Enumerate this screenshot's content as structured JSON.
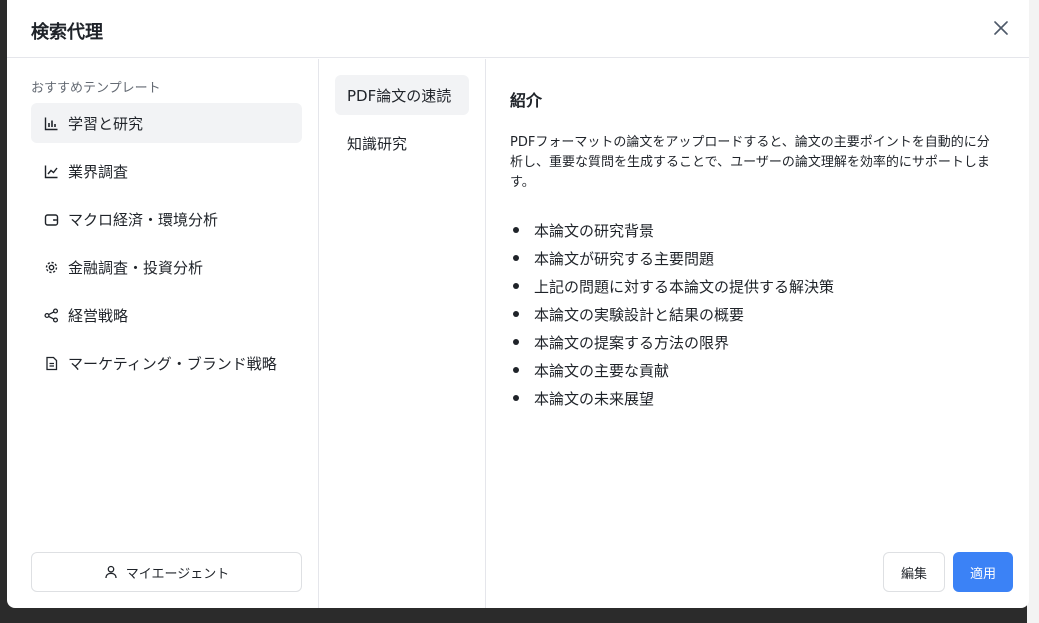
{
  "dialog": {
    "title": "検索代理"
  },
  "sidebar": {
    "section_label": "おすすめテンプレート",
    "items": [
      {
        "label": "学習と研究",
        "icon": "bar-chart-icon"
      },
      {
        "label": "業界調査",
        "icon": "line-chart-icon"
      },
      {
        "label": "マクロ経済・環境分析",
        "icon": "wallet-icon"
      },
      {
        "label": "金融調査・投資分析",
        "icon": "gear-icon"
      },
      {
        "label": "経営戦略",
        "icon": "share-icon"
      },
      {
        "label": "マーケティング・ブランド戦略",
        "icon": "document-icon"
      }
    ],
    "my_agent_label": "マイエージェント"
  },
  "templates": {
    "items": [
      {
        "label": "PDF論文の速読"
      },
      {
        "label": "知識研究"
      }
    ]
  },
  "detail": {
    "heading": "紹介",
    "description": "PDFフォーマットの論文をアップロードすると、論文の主要ポイントを自動的に分析し、重要な質問を生成することで、ユーザーの論文理解を効率的にサポートします。",
    "bullets": [
      "本論文の研究背景",
      "本論文が研究する主要問題",
      "上記の問題に対する本論文の提供する解決策",
      "本論文の実験設計と結果の概要",
      "本論文の提案する方法の限界",
      "本論文の主要な貢献",
      "本論文の未来展望"
    ]
  },
  "actions": {
    "edit_label": "編集",
    "apply_label": "適用"
  },
  "colors": {
    "accent": "#3b82f6",
    "active_bg": "#f2f3f5",
    "border": "#e5e6eb"
  }
}
